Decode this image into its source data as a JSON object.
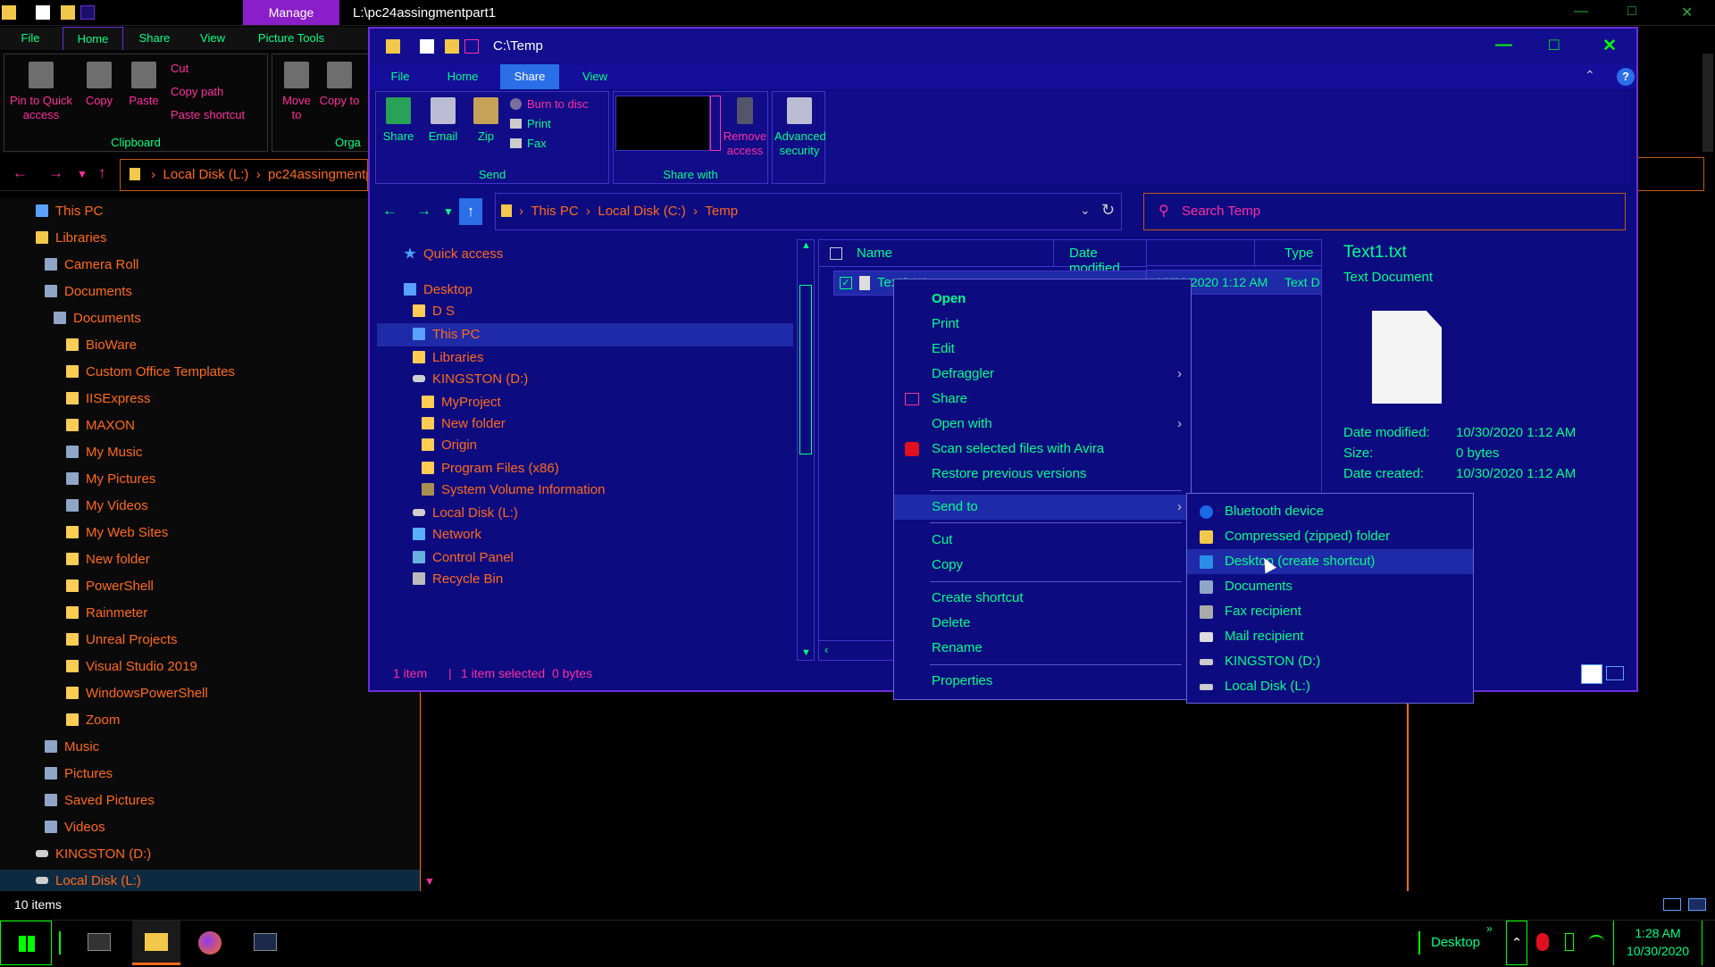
{
  "back_window": {
    "title_path": "L:\\pc24assingmentpart1",
    "manage_label": "Manage",
    "tabs": [
      "File",
      "Home",
      "Share",
      "View",
      "Picture Tools"
    ],
    "ribbon": {
      "pin_label": "Pin to Quick access",
      "copy_label": "Copy",
      "paste_label": "Paste",
      "cut_label": "Cut",
      "copy_path_label": "Copy path",
      "paste_shortcut_label": "Paste shortcut",
      "clipboard_group": "Clipboard",
      "move_to_label": "Move to",
      "copy_to_label": "Copy to",
      "organize_group": "Orga"
    },
    "address": [
      "Local Disk (L:)",
      "pc24assingmentp"
    ],
    "tree": [
      "This PC",
      "Libraries",
      "Camera Roll",
      "Documents",
      "Documents",
      "BioWare",
      "Custom Office Templates",
      "IISExpress",
      "MAXON",
      "My Music",
      "My Pictures",
      "My Videos",
      "My Web Sites",
      "New folder",
      "PowerShell",
      "Rainmeter",
      "Unreal Projects",
      "Visual Studio 2019",
      "WindowsPowerShell",
      "Zoom",
      "Music",
      "Pictures",
      "Saved Pictures",
      "Videos",
      "KINGSTON (D:)",
      "Local Disk (L:)"
    ],
    "status": "10 items"
  },
  "front_window": {
    "title_path": "C:\\Temp",
    "tabs": [
      "File",
      "Home",
      "Share",
      "View"
    ],
    "selected_tab": "Share",
    "ribbon": {
      "share_label": "Share",
      "email_label": "Email",
      "zip_label": "Zip",
      "burn_label": "Burn to disc",
      "print_label": "Print",
      "fax_label": "Fax",
      "send_group": "Send",
      "remove_access_label": "Remove access",
      "share_with_group": "Share with",
      "advanced_security_label": "Advanced security"
    },
    "address": [
      "This PC",
      "Local Disk (C:)",
      "Temp"
    ],
    "search_placeholder": "Search Temp",
    "tree": [
      "Quick access",
      "Desktop",
      "D S",
      "This PC",
      "Libraries",
      "KINGSTON (D:)",
      "MyProject",
      "New folder",
      "Origin",
      "Program Files (x86)",
      "System Volume Information",
      "Local Disk (L:)",
      "Network",
      "Control Panel",
      "Recycle Bin"
    ],
    "columns": [
      "Name",
      "Date modified",
      "Type"
    ],
    "file_row": {
      "name": "Text1.txt",
      "date": "10/30/2020 1:12 AM",
      "type": "Text D"
    },
    "preview": {
      "name": "Text1.txt",
      "kind": "Text Document",
      "date_modified_label": "Date modified:",
      "date_modified": "10/30/2020 1:12 AM",
      "size_label": "Size:",
      "size": "0 bytes",
      "date_created_label": "Date created:",
      "date_created": "10/30/2020 1:12 AM"
    },
    "status": {
      "items": "1 item",
      "selected": "1 item selected  0 bytes"
    }
  },
  "context_menu": {
    "items": [
      "Open",
      "Print",
      "Edit",
      "Defraggler",
      "Share",
      "Open with",
      "Scan selected files with Avira",
      "Restore previous versions",
      "Send to",
      "Cut",
      "Copy",
      "Create shortcut",
      "Delete",
      "Rename",
      "Properties"
    ]
  },
  "send_to_menu": {
    "items": [
      "Bluetooth device",
      "Compressed (zipped) folder",
      "Desktop (create shortcut)",
      "Documents",
      "Fax recipient",
      "Mail recipient",
      "KINGSTON (D:)",
      "Local Disk (L:)"
    ]
  },
  "taskbar": {
    "desktop_label": "Desktop",
    "time": "1:28 AM",
    "date": "10/30/2020",
    "colors": {
      "accent": "#6c2fd6",
      "text_green": "#00ff88",
      "text_orange": "#ff6a1a",
      "text_pink": "#ff2fa0"
    }
  }
}
